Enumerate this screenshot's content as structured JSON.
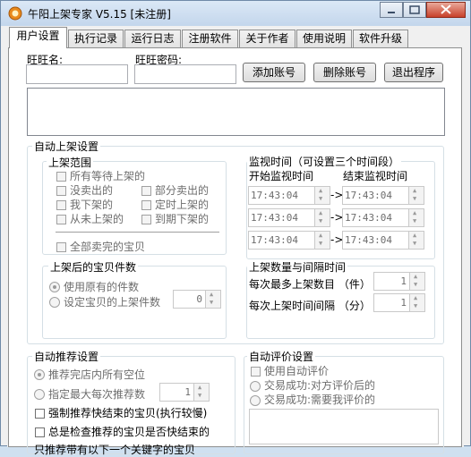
{
  "window": {
    "title": "午阳上架专家 V5.15 [未注册]"
  },
  "tabs": [
    "用户设置",
    "执行记录",
    "运行日志",
    "注册软件",
    "关于作者",
    "使用说明",
    "软件升级"
  ],
  "account": {
    "name_label": "旺旺名:",
    "password_label": "旺旺密码:",
    "add_button": "添加账号",
    "delete_button": "删除账号",
    "exit_button": "退出程序"
  },
  "auto_listing": {
    "title": "自动上架设置",
    "scope": {
      "title": "上架范围",
      "items": [
        "所有等待上架的",
        "没卖出的",
        "部分卖出的",
        "我下架的",
        "定时上架的",
        "从未上架的",
        "到期下架的",
        "全部卖完的宝贝"
      ]
    },
    "monitor": {
      "title": "监视时间（可设置三个时间段）",
      "start_label": "开始监视时间",
      "end_label": "结束监视时间",
      "arrow": "->",
      "periods": [
        {
          "start": "17:43:04",
          "end": "17:43:04"
        },
        {
          "start": "17:43:04",
          "end": "17:43:04"
        },
        {
          "start": "17:43:04",
          "end": "17:43:04"
        }
      ]
    },
    "count": {
      "title": "上架后的宝贝件数",
      "option_original": "使用原有的件数",
      "option_set": "设定宝贝的上架件数",
      "value": "0"
    },
    "interval": {
      "title": "上架数量与间隔时间",
      "min_label": "每次最多上架数目 （件）",
      "min_value": "1",
      "interval_label": "每次上架时间间隔 （分）",
      "interval_value": "1"
    }
  },
  "recommend": {
    "title": "自动推荐设置",
    "option_all": "推荐完店内所有空位",
    "option_max": "指定最大每次推荐数",
    "max_value": "1",
    "force_label": "强制推荐快结束的宝贝(执行较慢)",
    "check_label": "总是检查推荐的宝贝是否快结束的",
    "keyword_label": "只推荐带有以下一个关键字的宝贝"
  },
  "review": {
    "title": "自动评价设置",
    "use_label": "使用自动评价",
    "option_after": "交易成功:对方评价后的",
    "option_need": "交易成功:需要我评价的"
  }
}
